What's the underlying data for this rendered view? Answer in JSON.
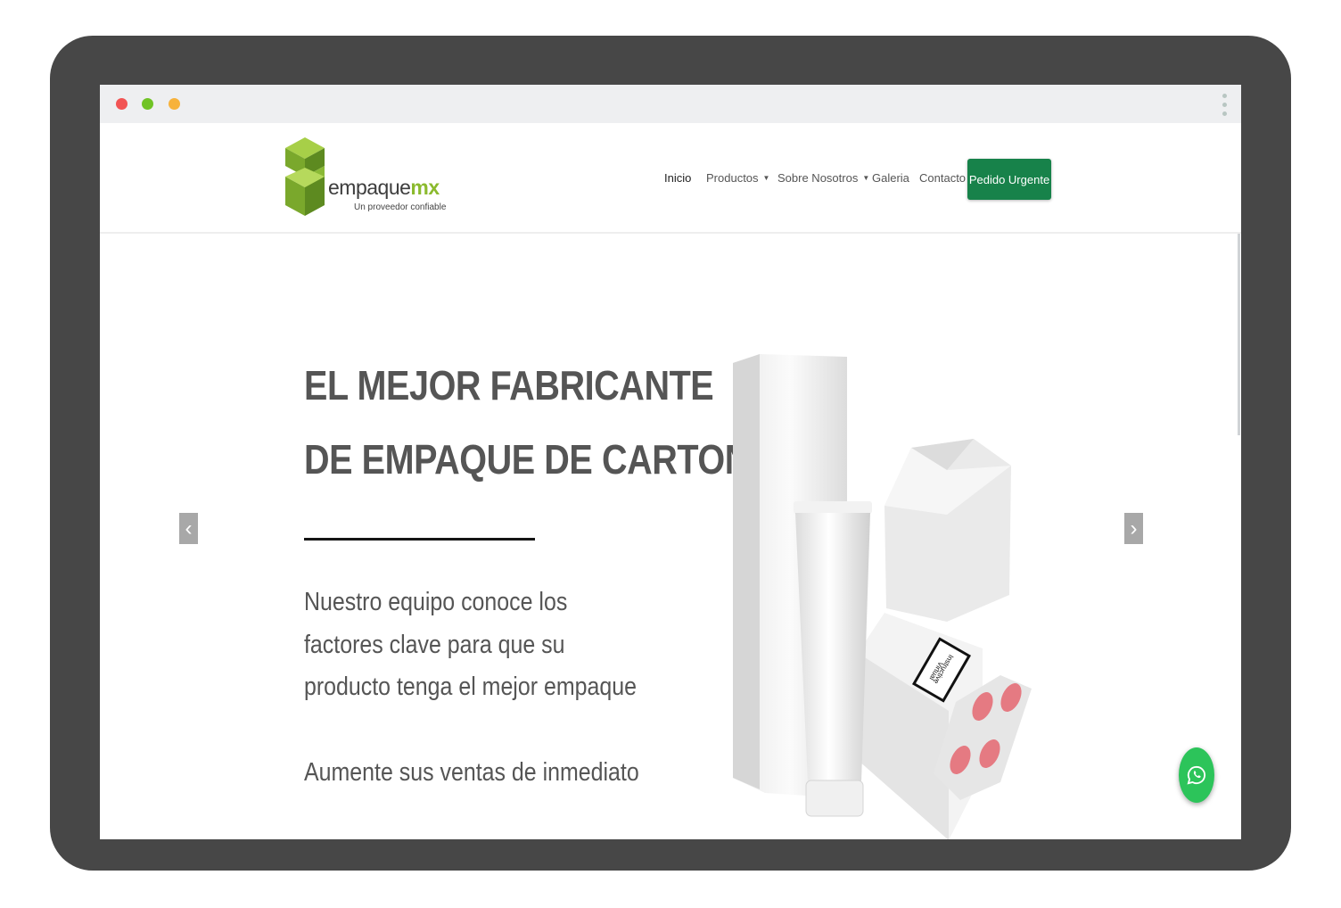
{
  "brand": {
    "name_main": "empaque",
    "name_accent": "mx",
    "tagline": "Un proveedor confiable",
    "accent_color": "#8bba2e"
  },
  "nav": {
    "items": [
      {
        "label": "Inicio",
        "active": true
      },
      {
        "label": "Productos",
        "dropdown": true
      },
      {
        "label": "Sobre Nosotros",
        "dropdown": true
      },
      {
        "label": "Galeria"
      },
      {
        "label": "Contacto"
      }
    ],
    "cta_label": "Pedido Urgente",
    "cta_color": "#17824a"
  },
  "hero": {
    "headline_1": "EL MEJOR FABRICANTE",
    "headline_2": "DE EMPAQUE DE CARTON",
    "body_1": "Nuestro equipo conoce los",
    "body_2": "factores clave para que su",
    "body_3": "producto tenga el mejor empaque",
    "body_4": "Aumente sus ventas de inmediato",
    "prev_icon": "chevron-left-icon",
    "next_icon": "chevron-right-icon",
    "box_label": "Instructive Virtual"
  },
  "widgets": {
    "whatsapp_icon": "whatsapp-icon",
    "whatsapp_color": "#2cc45a"
  }
}
